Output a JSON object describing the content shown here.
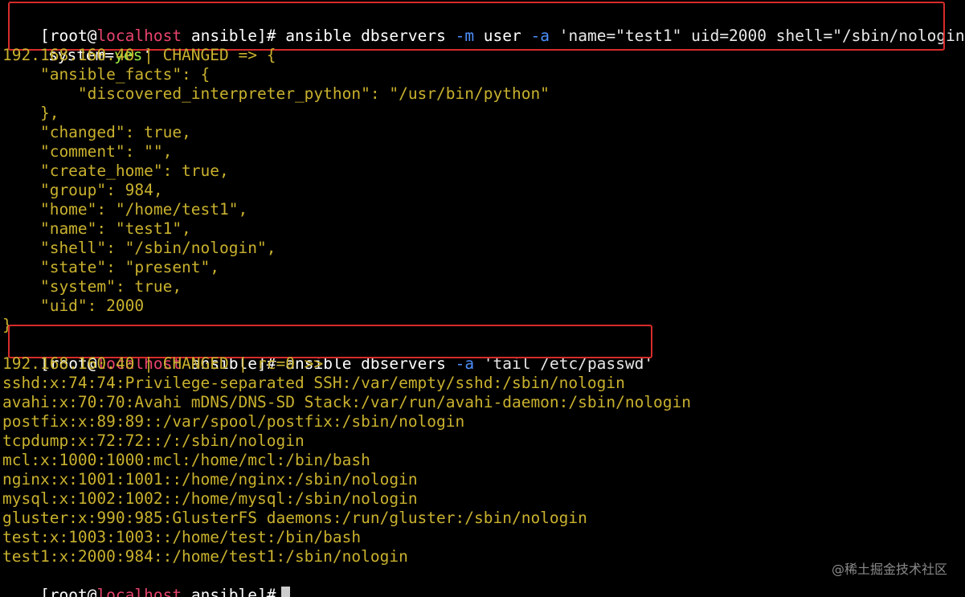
{
  "prompt": {
    "open_bracket": "[",
    "user": "root",
    "at": "@",
    "host": "localhost",
    "dir": " ansible",
    "close": "]#"
  },
  "command1": {
    "line1": {
      "prog": " ansible dbservers ",
      "flag_m": "-m",
      "module": " user ",
      "flag_a": "-a",
      "arg": " 'name=\"test1\" uid=2000 shell=\"/sbin/nologin\""
    },
    "line2": {
      "key": "system=",
      "value": "yes",
      "quote": "'"
    }
  },
  "output1": {
    "header": "192.168.160.40 | CHANGED => {",
    "lines": [
      "    \"ansible_facts\": {",
      "        \"discovered_interpreter_python\": \"/usr/bin/python\"",
      "    },",
      "    \"changed\": true,",
      "    \"comment\": \"\",",
      "    \"create_home\": true,",
      "    \"group\": 984,",
      "    \"home\": \"/home/test1\",",
      "    \"name\": \"test1\",",
      "    \"shell\": \"/sbin/nologin\",",
      "    \"state\": \"present\",",
      "    \"system\": true,",
      "    \"uid\": 2000"
    ],
    "footer": "}"
  },
  "command2": {
    "prog": " ansible dbservers ",
    "flag_a": "-a",
    "arg": " 'tail /etc/passwd'"
  },
  "output2": {
    "header": "192.168.160.40 | CHANGED | rc=0 >>",
    "lines": [
      "sshd:x:74:74:Privilege-separated SSH:/var/empty/sshd:/sbin/nologin",
      "avahi:x:70:70:Avahi mDNS/DNS-SD Stack:/var/run/avahi-daemon:/sbin/nologin",
      "postfix:x:89:89::/var/spool/postfix:/sbin/nologin",
      "tcpdump:x:72:72::/:/sbin/nologin",
      "mcl:x:1000:1000:mcl:/home/mcl:/bin/bash",
      "nginx:x:1001:1001::/home/nginx:/sbin/nologin",
      "mysql:x:1002:1002::/home/mysql:/sbin/nologin",
      "gluster:x:990:985:GlusterFS daemons:/run/gluster:/sbin/nologin",
      "test:x:1003:1003::/home/test:/bin/bash",
      "test1:x:2000:984::/home/test1:/sbin/nologin"
    ]
  },
  "watermark": "@稀土掘金技术社区",
  "colors": {
    "background": "#000000",
    "prompt_text": "#ffffff",
    "hostname": "#e8436c",
    "flag": "#4d8ffb",
    "output": "#c9b12e",
    "value_yes": "#97e84a",
    "highlight_box": "#d62b2b"
  }
}
